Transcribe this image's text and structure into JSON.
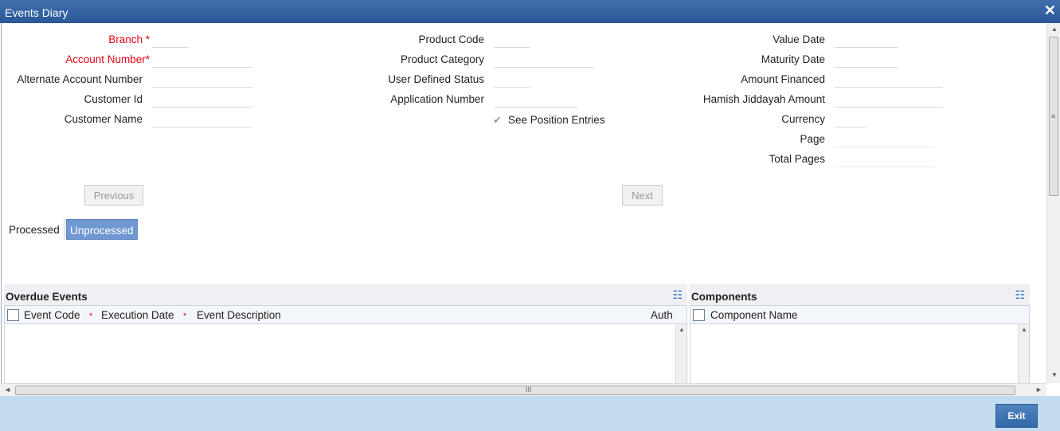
{
  "window": {
    "title": "Events Diary",
    "close_icon": "✕"
  },
  "form": {
    "branch_label": "Branch",
    "account_number_label": "Account Number",
    "alternate_account_label": "Alternate Account Number",
    "customer_id_label": "Customer Id",
    "customer_name_label": "Customer Name",
    "required_marker": "*",
    "product_code_label": "Product Code",
    "product_category_label": "Product Category",
    "user_defined_status_label": "User Defined Status",
    "application_number_label": "Application Number",
    "see_position_label": "See Position Entries",
    "value_date_label": "Value Date",
    "maturity_date_label": "Maturity Date",
    "amount_financed_label": "Amount Financed",
    "hamish_label": "Hamish Jiddayah Amount",
    "currency_label": "Currency",
    "page_label": "Page",
    "total_pages_label": "Total Pages"
  },
  "nav": {
    "previous_label": "Previous",
    "next_label": "Next"
  },
  "tabs": [
    {
      "label": "Processed",
      "active": false
    },
    {
      "label": "Unprocessed",
      "active": true
    }
  ],
  "overdue": {
    "title": "Overdue Events",
    "columns": [
      "Event Code",
      "Execution Date",
      "Event Description",
      "Auth"
    ],
    "required_marker": "*"
  },
  "components": {
    "title": "Components",
    "columns": [
      "Component Name"
    ]
  },
  "footer": {
    "exit_label": "Exit"
  },
  "icons": {
    "list_icon": "☷",
    "up_arrow": "▲",
    "down_arrow": "▼",
    "left_arrow": "◄",
    "right_arrow": "►",
    "grip": "≡",
    "hgrip": "III",
    "check": "✔"
  },
  "colors": {
    "title_bar": "#2b5796",
    "required": "#e30613",
    "active_tab": "#7099d3",
    "footer": "#c3dbef"
  }
}
